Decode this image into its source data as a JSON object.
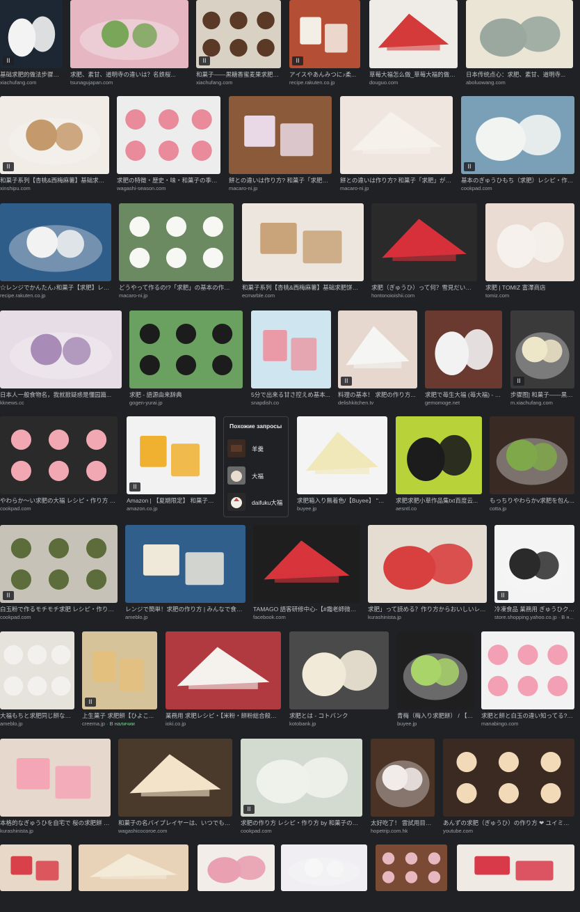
{
  "colors": {
    "background": "#202124",
    "caption": "#bdc1c6",
    "source": "#9aa0a6",
    "accent_green": "#81c995"
  },
  "related": {
    "title": "Похожие запросы",
    "items": [
      {
        "label": "羊羹",
        "color": "#5b3a2a"
      },
      {
        "label": "大福",
        "color": "#e8ddd0"
      },
      {
        "label": "daifuku大福",
        "color": "#c94a4a"
      }
    ]
  },
  "tiles": [
    {
      "caption": "基础求肥的做法步骤图...",
      "source": "xiachufang.com",
      "badge": true,
      "bg": "#1c2733",
      "fg": "#f3f3f3"
    },
    {
      "caption": "求肥、素甘、道明寺の違いは？名鉄桜...",
      "source": "tsunagujapan.com",
      "badge": false,
      "bg": "#e7b6c3",
      "fg": "#7aa65a"
    },
    {
      "caption": "和菓子——黒糖香蜜麦果求肥的...",
      "source": "xiachufang.com",
      "badge": true,
      "bg": "#d9d2c4",
      "fg": "#5a3a26"
    },
    {
      "caption": "アイスやあんみつに♪柔...",
      "source": "recipe.rakuten.co.jp",
      "badge": true,
      "bg": "#b44f35",
      "fg": "#f4efe6"
    },
    {
      "caption": "草莓大福怎么做_草莓大福的做法...",
      "source": "douguo.com",
      "badge": false,
      "bg": "#efece8",
      "fg": "#d43a3a"
    },
    {
      "caption": "日本传统点心：求肥、素甘、道明寺...",
      "source": "aboluowang.com",
      "badge": false,
      "bg": "#ebe5d6",
      "fg": "#9aa8a0"
    },
    {
      "caption": "和菓子系列【杏桃&西梅麻薯】基础求肥饼...",
      "source": "xinshipu.com",
      "badge": true,
      "bg": "#f1ede6",
      "fg": "#c49a6c"
    },
    {
      "caption": "求肥の特徴・歴史・味・和菓子の季節.c...",
      "source": "wagashi-season.com",
      "badge": false,
      "bg": "#ededed",
      "fg": "#e98b9a"
    },
    {
      "caption": "餅との違いは作り方? 和菓子「求肥」が...",
      "source": "macaro-ni.jp",
      "badge": false,
      "bg": "#8a5a3a",
      "fg": "#e9d9e6"
    },
    {
      "caption": "餅との違いは作り方? 和菓子「求肥」が時...",
      "source": "macaro-ni.jp",
      "badge": false,
      "bg": "#f0e6e0",
      "fg": "#f6f1ea"
    },
    {
      "caption": "基本のぎゅうひもち（求肥）レシピ・作り...",
      "source": "cookpad.com",
      "badge": true,
      "bg": "#7aa0b8",
      "fg": "#f2f4f2"
    },
    {
      "caption": "☆レンジでかんたん♪和菓子【求肥】レシ...",
      "source": "recipe.rakuten.co.jp",
      "badge": false,
      "bg": "#2e5d8a",
      "fg": "#f2f2f2"
    },
    {
      "caption": "どうやって作るの!?「求肥」の基本の作り方...",
      "source": "macaro-ni.jp",
      "badge": false,
      "bg": "#6b8a62",
      "fg": "#f7f7f3"
    },
    {
      "caption": "和菓子系列【杏桃&西梅麻薯】基础求肥饼皮的...",
      "source": "ecmarble.com",
      "badge": false,
      "bg": "#ece6de",
      "fg": "#c9a37a"
    },
    {
      "caption": "求肥（ぎゅうひ）って何？雪見だいふく...",
      "source": "hontonoioishii.com",
      "badge": false,
      "bg": "#2a2a2a",
      "fg": "#d8303a"
    },
    {
      "caption": "求肥 | TOMIZ 富澤商店",
      "source": "tomiz.com",
      "badge": false,
      "bg": "#eadbd3",
      "fg": "#f6f1ec"
    },
    {
      "caption": "日本人一般食物名，我就掀疑惑是懂园篇...",
      "source": "kknews.cc",
      "badge": false,
      "bg": "#e6dde6",
      "fg": "#a88bb6"
    },
    {
      "caption": "求肥 - 語源由来辞典",
      "source": "gogen-yurai.jp",
      "badge": false,
      "bg": "#6aa060",
      "fg": "#1c1c1c"
    },
    {
      "caption": "5分で出来る甘さ控えめ基本...",
      "source": "snapdish.co",
      "badge": false,
      "bg": "#cfe6f0",
      "fg": "#e99aa6"
    },
    {
      "caption": "料理の基本！ 求肥の作り方...",
      "source": "delishkitchen.tv",
      "badge": true,
      "bg": "#e7d8cf",
      "fg": "#f5f5f3"
    },
    {
      "caption": "求肥で苺生大福 (苺大福) - き...",
      "source": "gemomoge.net",
      "badge": false,
      "bg": "#6a3a30",
      "fg": "#f2f2f2"
    },
    {
      "caption": "步骤图] 和菓子——黒糖...",
      "source": "m.xiachufang.com",
      "badge": true,
      "bg": "#3a3a3a",
      "fg": "#eee6c8"
    },
    {
      "caption": "やわらか〜い求肥の大福 レシピ・作り方 by ☆...",
      "source": "cookpad.com",
      "badge": false,
      "bg": "#2a2a2a",
      "fg": "#f2a8b2"
    },
    {
      "caption": "Amazon | 【夏期限定】 和菓子屋...",
      "source": "amazon.co.jp",
      "badge": true,
      "bg": "#f2f2f2",
      "fg": "#f0b030"
    },
    {
      "caption": "求肥箱入り無着色/【Buyee】 \"Bu...",
      "source": "buyee.jp",
      "badge": false,
      "bg": "#f4f4f4",
      "fg": "#f0e8b8"
    },
    {
      "caption": "求肥求肥小草作品集txt百度云...",
      "source": "aesntl.co",
      "badge": false,
      "bg": "#b8d23a",
      "fg": "#1c1c1c"
    },
    {
      "caption": "もっちりやわらかv求肥を包ん...",
      "source": "cotta.jp",
      "badge": false,
      "bg": "#3a2a24",
      "fg": "#7fa84a"
    },
    {
      "caption": "白玉粉で作るモチモチ求肥 レシピ・作り方 by...",
      "source": "cookpad.com",
      "badge": true,
      "bg": "#c6c2b8",
      "fg": "#5c6c3a"
    },
    {
      "caption": "レンジで簡単！求肥の作り方 | みんなで食べよ...",
      "source": "ameblo.jp",
      "badge": false,
      "bg": "#2f5f8a",
      "fg": "#efe9da"
    },
    {
      "caption": "TAMAGO 語客研修中心-【#霜老師微觀日...",
      "source": "facebook.com",
      "badge": false,
      "bg": "#1e1e1e",
      "fg": "#d8343c"
    },
    {
      "caption": "求肥」って読める？作り方からおいしいレシ...",
      "source": "kurashinista.jp",
      "badge": false,
      "bg": "#e6ddd2",
      "fg": "#d84040"
    },
    {
      "caption": "冷凍食品 業務用 ぎゅうひクリ...",
      "source": "store.shopping.yahoo.co.jp · В н...",
      "badge": true,
      "bg": "#f4f4f4",
      "fg": "#2a2a2a"
    },
    {
      "caption": "大福もちと求肥同じ餅なの...",
      "source": "ameblo.jp",
      "badge": false,
      "bg": "#e6e2dc",
      "fg": "#f3f1ed"
    },
    {
      "caption": "上生菓子 求肥餅【ひよこ...",
      "source": "creema.jp · ",
      "stock": "В наличии",
      "badge": true,
      "bg": "#d7c39a",
      "fg": "#e3c07e"
    },
    {
      "caption": "業務用 求肥レシピ・【米粉・餅粉総合殺粉メ...",
      "source": "ioki.co.jp",
      "badge": false,
      "bg": "#b03a40",
      "fg": "#f5f2ee"
    },
    {
      "caption": "求肥とは - コトバンク",
      "source": "kotobank.jp",
      "badge": false,
      "bg": "#4a4a4a",
      "fg": "#f2ead8"
    },
    {
      "caption": "青梅（梅入り求肥餅） / 【B...",
      "source": "buyee.jp",
      "badge": false,
      "bg": "#1f1f1f",
      "fg": "#a9d46a"
    },
    {
      "caption": "求肥と餅と白玉の違い知ってる?羽...",
      "source": "manabingo.com",
      "badge": false,
      "bg": "#f2f2f2",
      "fg": "#f3a0b4"
    },
    {
      "caption": "本格的なぎゅうひを自宅で 桜の求肥餅 - 暮...",
      "source": "kurashinista.jp",
      "badge": false,
      "bg": "#e6d8cc",
      "fg": "#f4a6b6"
    },
    {
      "caption": "和菓子の名バイプレイヤーは、いつでもモ...",
      "source": "wagashicocoroe.com",
      "badge": false,
      "bg": "#4a3a2c",
      "fg": "#f3e3c8"
    },
    {
      "caption": "求肥の作り方 レシピ・作り方 by 和菓子の早稲...",
      "source": "cookpad.com",
      "badge": true,
      "bg": "#d3dbd0",
      "fg": "#eef2ea"
    },
    {
      "caption": "太好吃了！ 雲試用目製...",
      "source": "hopetrip.com.hk",
      "badge": false,
      "bg": "#4a3224",
      "fg": "#f1ecea"
    },
    {
      "caption": "あんずの求肥（ぎゅうひ）の作り方 ❤ ユイミコの...",
      "source": "youtube.com",
      "badge": false,
      "bg": "#3a2a22",
      "fg": "#f2d9b8"
    },
    {
      "caption": "",
      "source": "",
      "badge": false,
      "bg": "#e8d8c8",
      "fg": "#d8404a"
    },
    {
      "caption": "",
      "source": "",
      "badge": false,
      "bg": "#e8d2b8",
      "fg": "#f4ead8"
    },
    {
      "caption": "",
      "source": "",
      "badge": false,
      "bg": "#f2ede8",
      "fg": "#e9a0b0"
    },
    {
      "caption": "",
      "source": "",
      "badge": false,
      "bg": "#f0eef2",
      "fg": "#f7f7f7"
    },
    {
      "caption": "",
      "source": "",
      "badge": false,
      "bg": "#7a4a34",
      "fg": "#e8b8c0"
    },
    {
      "caption": "",
      "source": "",
      "badge": false,
      "bg": "#f0eae4",
      "fg": "#d83a4a"
    }
  ]
}
